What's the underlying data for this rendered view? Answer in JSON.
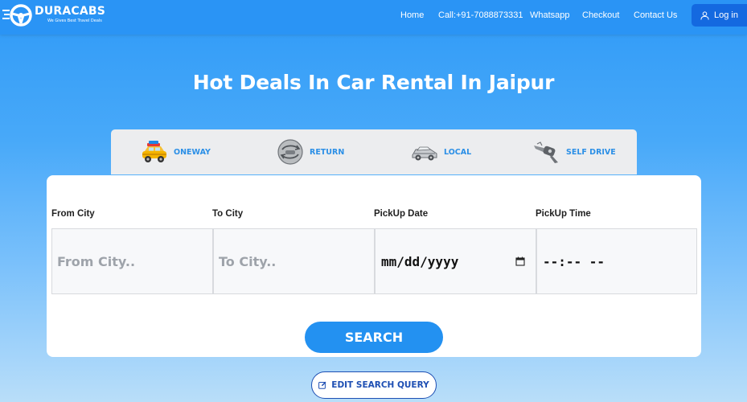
{
  "header": {
    "logo_name": "DURACABS",
    "logo_tagline": "We Gives Best Travel Deals",
    "nav": [
      {
        "label": "Home",
        "icon": ""
      },
      {
        "label": "Call:+91-7088873331",
        "icon": ""
      },
      {
        "label": "Whatsapp",
        "icon": ""
      },
      {
        "label": "Checkout",
        "icon": ""
      },
      {
        "label": "Contact Us",
        "icon": ""
      }
    ],
    "login_label": "Log in",
    "login_icon": "user-icon"
  },
  "hero": {
    "title": "Hot Deals In Car Rental In Jaipur"
  },
  "trip_tabs": [
    {
      "label": "ONEWAY",
      "icon": "taxi-icon"
    },
    {
      "label": "RETURN",
      "icon": "return-trip-icon"
    },
    {
      "label": "LOCAL",
      "icon": "local-car-icon"
    },
    {
      "label": "SELF DRIVE",
      "icon": "car-key-icon"
    }
  ],
  "search_form": {
    "from_city": {
      "label": "From City",
      "placeholder": "From City.."
    },
    "to_city": {
      "label": "To City",
      "placeholder": "To City.."
    },
    "pickup_date": {
      "label": "PickUp Date",
      "value": "mm/dd/yyyy",
      "icon": "calendar-icon"
    },
    "pickup_time": {
      "label": "PickUp Time",
      "value": "--:-- --"
    },
    "search_label": "SEARCH"
  },
  "edit_query": {
    "label": "EDIT SEARCH QUERY",
    "icon": "edit-icon"
  },
  "colors": {
    "header_bg": "#2a94f5",
    "accent": "#2391f1",
    "tab_text": "#2b8fe6",
    "edit_border": "#1e4fb3"
  }
}
